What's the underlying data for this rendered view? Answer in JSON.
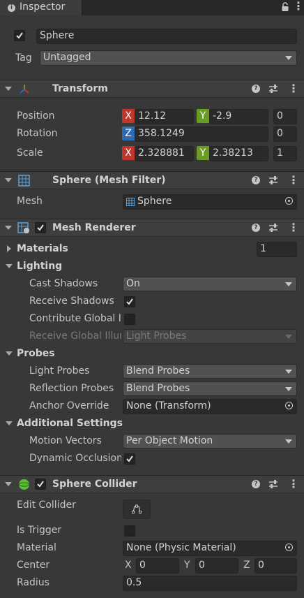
{
  "tab": {
    "title": "Inspector"
  },
  "object": {
    "active": true,
    "name": "Sphere",
    "tag_label": "Tag",
    "tag_value": "Untagged"
  },
  "transform": {
    "title": "Transform",
    "position": {
      "label": "Position",
      "x": "12.12",
      "y": "-2.9",
      "z": "0"
    },
    "rotation": {
      "label": "Rotation",
      "z": "358.1249",
      "extra": "0"
    },
    "scale": {
      "label": "Scale",
      "x": "2.328881",
      "y": "2.38213",
      "z": "1"
    }
  },
  "mesh_filter": {
    "title": "Sphere (Mesh Filter)",
    "mesh_label": "Mesh",
    "mesh_value": "Sphere"
  },
  "mesh_renderer": {
    "title": "Mesh Renderer",
    "materials_label": "Materials",
    "materials_count": "1",
    "lighting_label": "Lighting",
    "cast_shadows_label": "Cast Shadows",
    "cast_shadows_value": "On",
    "receive_shadows_label": "Receive Shadows",
    "contribute_gi_label": "Contribute Global Illumination",
    "receive_gi_label": "Receive Global Illumination",
    "receive_gi_value": "Light Probes",
    "probes_label": "Probes",
    "light_probes_label": "Light Probes",
    "light_probes_value": "Blend Probes",
    "reflection_probes_label": "Reflection Probes",
    "reflection_probes_value": "Blend Probes",
    "anchor_override_label": "Anchor Override",
    "anchor_override_value": "None (Transform)",
    "additional_label": "Additional Settings",
    "motion_vectors_label": "Motion Vectors",
    "motion_vectors_value": "Per Object Motion",
    "dynamic_occlusion_label": "Dynamic Occlusion"
  },
  "sphere_collider": {
    "title": "Sphere Collider",
    "edit_collider_label": "Edit Collider",
    "is_trigger_label": "Is Trigger",
    "material_label": "Material",
    "material_value": "None (Physic Material)",
    "center_label": "Center",
    "center": {
      "x_label": "X",
      "x": "0",
      "y_label": "Y",
      "y": "0",
      "z_label": "Z",
      "z": "0"
    },
    "radius_label": "Radius",
    "radius_value": "0.5"
  },
  "axis_labels": {
    "x": "X",
    "y": "Y",
    "z": "Z"
  },
  "colors": {
    "background": "#383838",
    "axis_x": "#c1362b",
    "axis_y": "#6a9b22",
    "axis_z": "#2d6bb5"
  }
}
